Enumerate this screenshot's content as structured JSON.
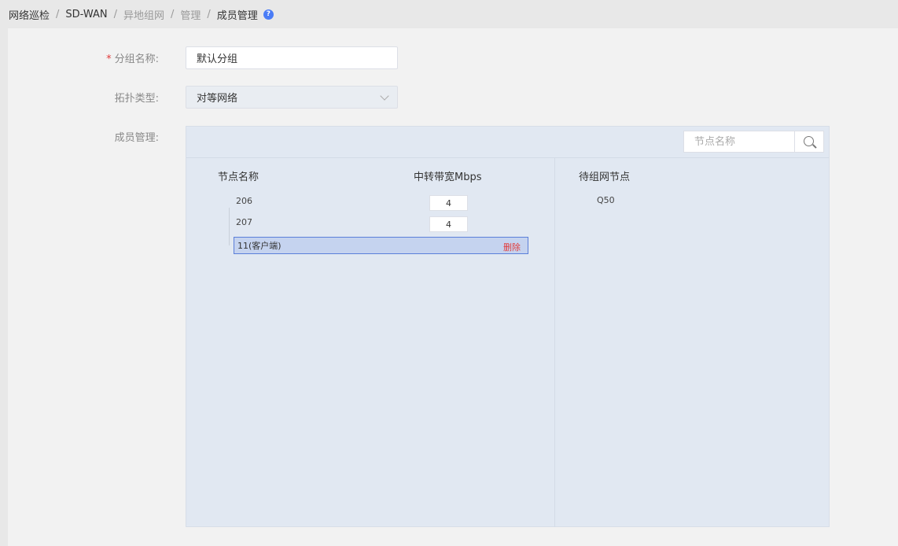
{
  "breadcrumb": {
    "items": [
      "网络巡检",
      "SD-WAN",
      "异地组网",
      "管理",
      "成员管理"
    ],
    "separator": "/",
    "help": "?"
  },
  "form": {
    "required_mark": "*",
    "group_name_label": "分组名称:",
    "group_name_value": "默认分组",
    "topology_label": "拓扑类型:",
    "topology_value": "对等网络",
    "member_label": "成员管理:"
  },
  "members": {
    "search_placeholder": "节点名称",
    "columns": {
      "node_name": "节点名称",
      "relay_bandwidth": "中转带宽Mbps",
      "pending_nodes": "待组网节点"
    },
    "rows": [
      {
        "name": "206",
        "bandwidth": "4"
      },
      {
        "name": "207",
        "bandwidth": "4"
      }
    ],
    "selected_row": {
      "name": "11(客户端)",
      "action": "删除"
    },
    "pending": [
      "Q50"
    ]
  },
  "colors": {
    "accent": "#4a7cf6",
    "danger": "#e23b3b",
    "panel_bg": "#e1e8f2",
    "selected_bg": "#c5d3ef",
    "selected_border": "#5b7fd9"
  }
}
